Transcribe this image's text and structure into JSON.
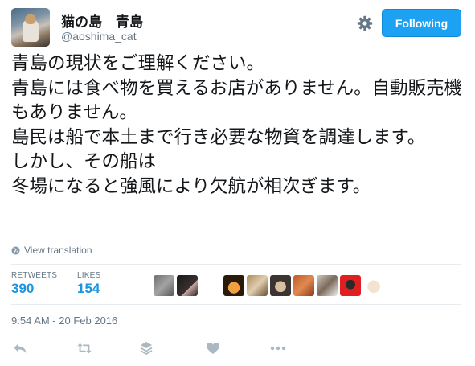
{
  "user": {
    "display_name": "猫の島　青島",
    "screen_name": "@aoshima_cat"
  },
  "follow_button": {
    "label": "Following"
  },
  "tweet": {
    "text": "青島の現状をご理解ください。\n青島には食べ物を買えるお店がありません。自動販売機もありません。\n島民は船で本土まで行き必要な物資を調達します。\nしかし、その船は\n冬場になると強風により欠航が相次ぎます。"
  },
  "translation": {
    "label": "View translation"
  },
  "stats": {
    "retweets_label": "RETWEETS",
    "retweets_value": "390",
    "likes_label": "LIKES",
    "likes_value": "154"
  },
  "timestamp": "9:54 AM - 20 Feb 2016",
  "colors": {
    "accent": "#1da1f2",
    "stat_blue": "#1b95e0",
    "muted": "#657786"
  },
  "icons": [
    "gear-icon",
    "globe-icon",
    "reply-icon",
    "retweet-icon",
    "stack-icon",
    "heart-icon",
    "more-icon"
  ]
}
